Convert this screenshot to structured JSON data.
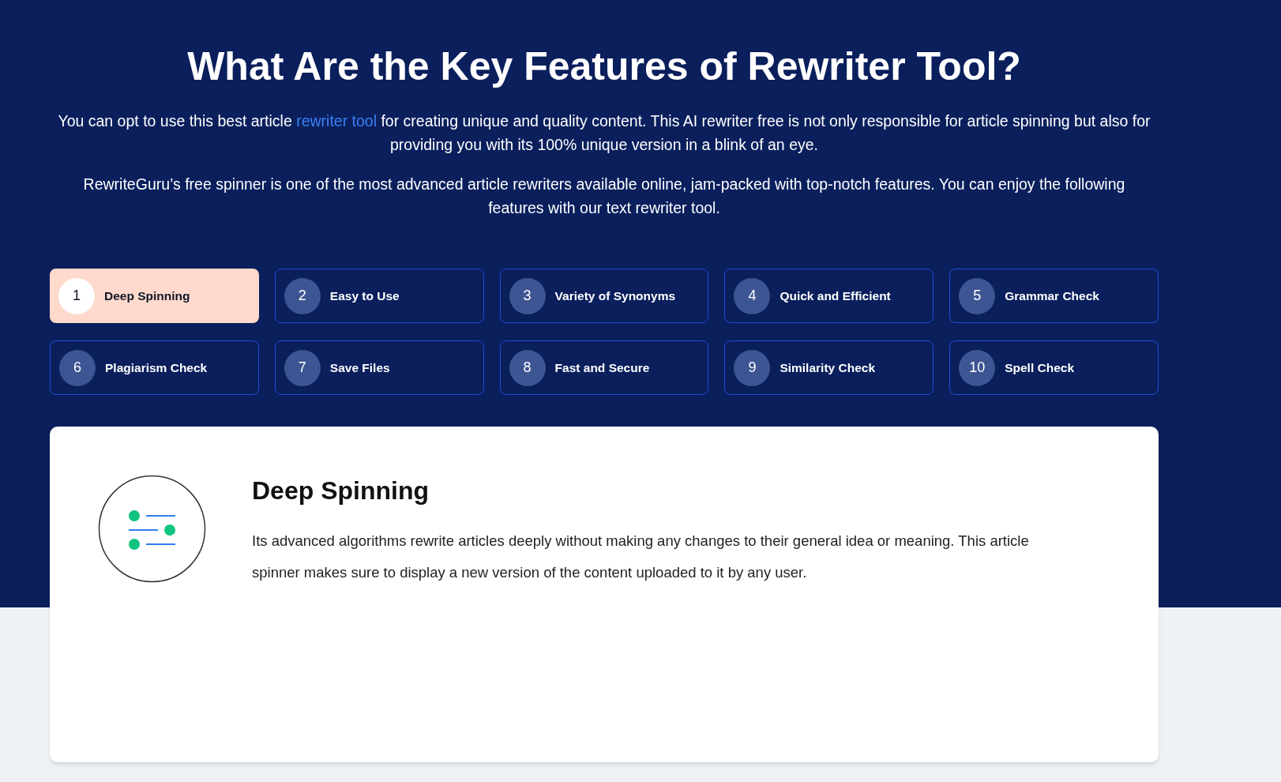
{
  "heading": "What Are the Key Features of Rewriter Tool?",
  "intro": [
    {
      "kind": "text",
      "text": "You can opt to use this best article "
    },
    {
      "kind": "link",
      "text": "rewriter tool"
    },
    {
      "kind": "text",
      "text": " for creating unique and quality content. This AI rewriter free is not only responsible for article spinning but also for providing you with its 100% unique version in a blink of an eye."
    }
  ],
  "paragraph": "RewriteGuru’s free spinner is one of the most advanced article rewriters available online, jam-packed with top-notch features. You can enjoy the following features with our text rewriter tool.",
  "tabs": [
    {
      "number": "1",
      "label": "Deep Spinning",
      "selected": true
    },
    {
      "number": "2",
      "label": "Easy to Use",
      "selected": false
    },
    {
      "number": "3",
      "label": "Variety of Synonyms",
      "selected": false
    },
    {
      "number": "4",
      "label": "Quick and Efficient",
      "selected": false
    },
    {
      "number": "5",
      "label": "Grammar Check",
      "selected": false
    },
    {
      "number": "6",
      "label": "Plagiarism Check",
      "selected": false
    },
    {
      "number": "7",
      "label": "Save Files",
      "selected": false
    },
    {
      "number": "8",
      "label": "Fast and Secure",
      "selected": false
    },
    {
      "number": "9",
      "label": "Similarity Check",
      "selected": false
    },
    {
      "number": "10",
      "label": "Spell Check",
      "selected": false
    }
  ],
  "detail": {
    "title": "Deep Spinning",
    "text": "Its advanced algorithms rewrite articles deeply without making any changes to their general idea or meaning. This article spinner makes sure to display a new version of the content uploaded to it by any user."
  }
}
